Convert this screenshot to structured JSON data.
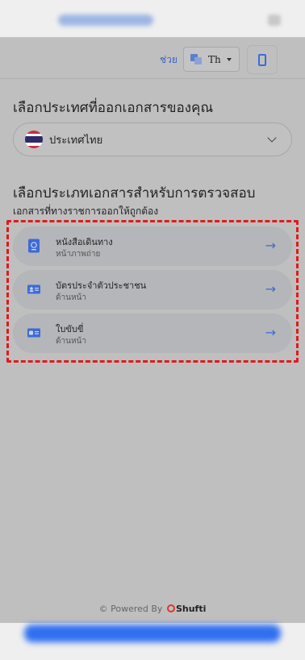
{
  "header": {
    "help_label": "ช่วย",
    "language_label": "Th",
    "accent_color": "#3d6bd6"
  },
  "country": {
    "title": "เลือกประเทศที่ออกเอกสารของคุณ",
    "selected": "ประเทศไทย",
    "flag_icon": "thailand-flag-icon"
  },
  "documents": {
    "title": "เลือกประเภทเอกสารสำหรับการตรวจสอบ",
    "subtitle": "เอกสารที่ทางราชการออกให้ถูกต้อง",
    "items": [
      {
        "name": "หนังสือเดินทาง",
        "side": "หน้าภาพถ่าย",
        "icon": "passport-icon"
      },
      {
        "name": "บัตรประจำตัวประชาชน",
        "side": "ด้านหน้า",
        "icon": "id-card-icon"
      },
      {
        "name": "ใบขับขี่",
        "side": "ด้านหน้า",
        "icon": "driving-license-icon"
      }
    ],
    "highlight_color": "#e11a1a"
  },
  "footer": {
    "powered_by": "© Powered By",
    "brand": "Shufti"
  }
}
